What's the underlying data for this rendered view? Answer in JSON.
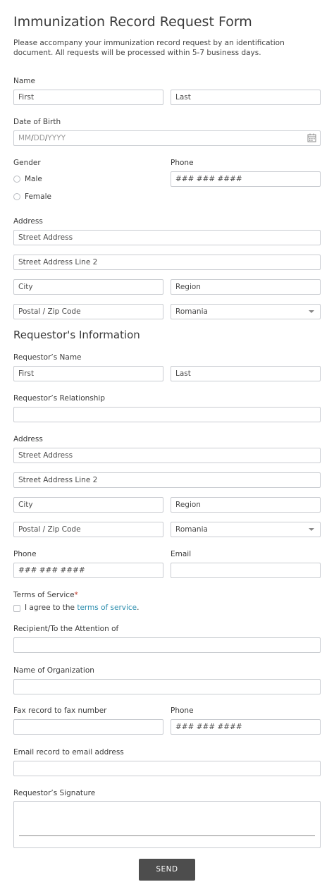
{
  "form": {
    "title": "Immunization Record Request Form",
    "description": "Please accompany your immunization record request by an identification document. All requests will be processed within 5-7 business days."
  },
  "patient": {
    "name_label": "Name",
    "first_placeholder": "First",
    "last_placeholder": "Last",
    "dob_label": "Date of Birth",
    "dob_placeholder_mm": "MM",
    "dob_placeholder_dd": "DD",
    "dob_placeholder_yyyy": "YYYY",
    "dob_sep": "/",
    "gender_label": "Gender",
    "gender_options": [
      "Male",
      "Female"
    ],
    "phone_label": "Phone",
    "phone_placeholder": "### ### ####",
    "address_label": "Address",
    "street_placeholder": "Street Address",
    "street2_placeholder": "Street Address Line 2",
    "city_placeholder": "City",
    "region_placeholder": "Region",
    "postal_placeholder": "Postal / Zip Code",
    "country_value": "Romania"
  },
  "requestor": {
    "section_title": "Requestor's Information",
    "name_label": "Requestor’s Name",
    "first_placeholder": "First",
    "last_placeholder": "Last",
    "relationship_label": "Requestor’s Relationship",
    "address_label": "Address",
    "street_placeholder": "Street Address",
    "street2_placeholder": "Street Address Line 2",
    "city_placeholder": "City",
    "region_placeholder": "Region",
    "postal_placeholder": "Postal / Zip Code",
    "country_value": "Romania",
    "phone_label": "Phone",
    "phone_placeholder": "### ### ####",
    "email_label": "Email",
    "tos_label": "Terms of Service",
    "tos_required_mark": "*",
    "tos_agree_text": "I agree to the ",
    "tos_link_text": "terms of service",
    "tos_period": ".",
    "recipient_label": "Recipient/To the Attention of",
    "organization_label": "Name of Organization",
    "fax_label": "Fax record to fax number",
    "fax_phone_label": "Phone",
    "fax_phone_placeholder": "### ### ####",
    "email_record_label": "Email record to email address",
    "signature_label": "Requestor’s Signature"
  },
  "actions": {
    "send_label": "SEND"
  },
  "icons": {
    "calendar": "calendar-icon",
    "dropdown": "chevron-down-icon"
  },
  "colors": {
    "send_button_bg": "#4d4d4d",
    "link": "#2a8cad",
    "required": "#c0392b",
    "border": "#c9ccd1"
  }
}
